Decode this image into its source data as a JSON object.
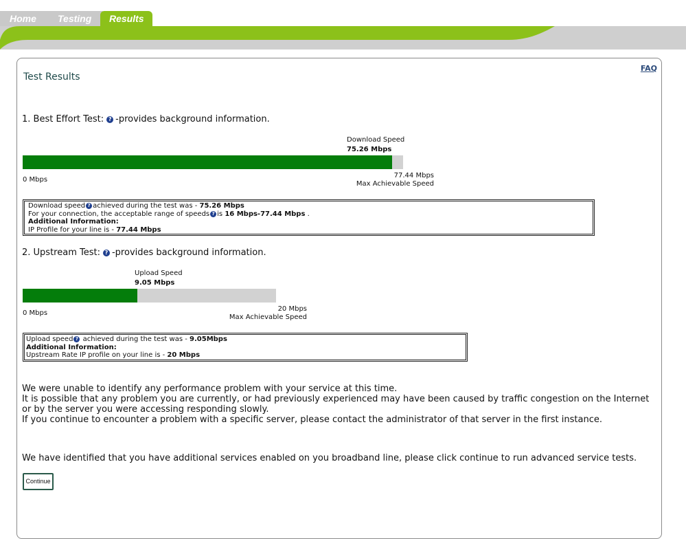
{
  "nav": {
    "tabs": [
      {
        "label": "Home"
      },
      {
        "label": "Testing"
      },
      {
        "label": "Results"
      }
    ]
  },
  "colors": {
    "accent": "#8cc11a",
    "bar_fill": "#047d0b",
    "bar_track": "#d2d2d2"
  },
  "page": {
    "faq": "FAQ",
    "title": "Test Results"
  },
  "download": {
    "heading": "1. Best Effort Test:",
    "heading_suffix": "-provides background information.",
    "speed_label": "Download Speed",
    "speed_value": "75.26 Mbps",
    "min_label": "0 Mbps",
    "max_value": "77.44 Mbps",
    "max_label": "Max Achievable Speed",
    "fill_fraction": 0.9718,
    "info": {
      "line1_pre": "Download speed",
      "line1_mid": "achieved during the test was - ",
      "line1_val": "75.26 Mbps",
      "line2_pre": "For your connection, the acceptable range of speeds",
      "line2_mid": "is ",
      "line2_val": "16 Mbps-77.44 Mbps",
      "line2_post": " .",
      "line3": "Additional Information:",
      "line4_pre": "IP Profile for your line is - ",
      "line4_val": "77.44 Mbps"
    }
  },
  "upload": {
    "heading": "2. Upstream Test:",
    "heading_suffix": "-provides background information.",
    "speed_label": "Upload Speed",
    "speed_value": "9.05 Mbps",
    "min_label": "0 Mbps",
    "max_value": "20 Mbps",
    "max_label": "Max Achievable Speed",
    "fill_fraction": 0.4525,
    "info": {
      "line1_pre": "Upload speed",
      "line1_mid": " achieved during the test was - ",
      "line1_val": "9.05Mbps",
      "line2": "Additional Information:",
      "line3_pre": "Upstream Rate IP profile on your line is - ",
      "line3_val": "20 Mbps"
    }
  },
  "message": {
    "p1": "We were unable to identify any performance problem with your service at this time.",
    "p2": "It is possible that any problem you are currently, or had previously experienced may have been caused by traffic congestion on the Internet or by the server you were accessing responding slowly.",
    "p3": "If you continue to encounter a problem with a specific server, please contact the administrator of that server in the first instance.",
    "p4": "We have identified that you have additional services enabled on you broadband line, please click continue to run advanced service tests."
  },
  "continue_label": "Continue"
}
